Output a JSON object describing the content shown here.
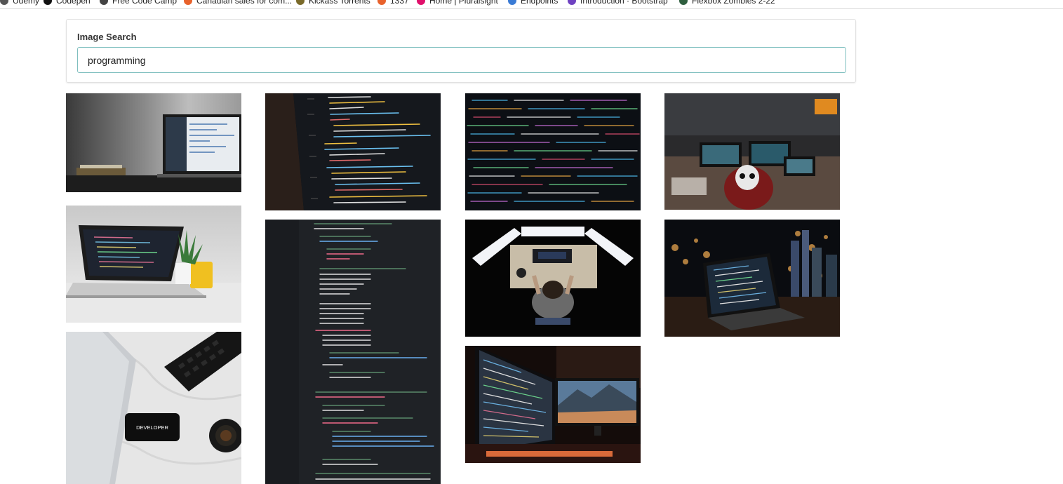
{
  "bookmarks": [
    {
      "label": "Udemy",
      "color": "#555555"
    },
    {
      "label": "Codepen",
      "color": "#111111"
    },
    {
      "label": "Free Code Camp",
      "color": "#444444"
    },
    {
      "label": "Canadian sales for com...",
      "color": "#e8622c"
    },
    {
      "label": "Kickass Torrents",
      "color": "#7a6a2a"
    },
    {
      "label": "1337",
      "color": "#e8622c"
    },
    {
      "label": "Home | Pluralsight",
      "color": "#e0106b"
    },
    {
      "label": "Endpoints",
      "color": "#3a7bd5"
    },
    {
      "label": "Introduction · Bootstrap",
      "color": "#6f42c1"
    },
    {
      "label": "Flexbox Zombies 2-22",
      "color": "#2e5e3e"
    }
  ],
  "search": {
    "label": "Image Search",
    "value": "programming",
    "accent_color": "#7fbfbf"
  },
  "images": [
    {
      "name": "laptop-on-desk-image",
      "theme": "laptop-white-wall"
    },
    {
      "name": "python-code-screen-image",
      "theme": "code-closeup"
    },
    {
      "name": "colorful-code-image",
      "theme": "colorful-code"
    },
    {
      "name": "hacker-skull-mask-image",
      "theme": "hacker-room"
    },
    {
      "name": "macbook-code-plant-image",
      "theme": "macbook-plant"
    },
    {
      "name": "javascript-code-image",
      "theme": "js-code"
    },
    {
      "name": "developer-three-monitors-image",
      "theme": "three-monitors"
    },
    {
      "name": "laptop-city-night-image",
      "theme": "city-laptop"
    },
    {
      "name": "developer-keyboard-phone-image",
      "theme": "developer-desk",
      "text": "DEVELOPER"
    },
    {
      "name": "dual-monitor-setup-image",
      "theme": "dual-monitor"
    }
  ]
}
